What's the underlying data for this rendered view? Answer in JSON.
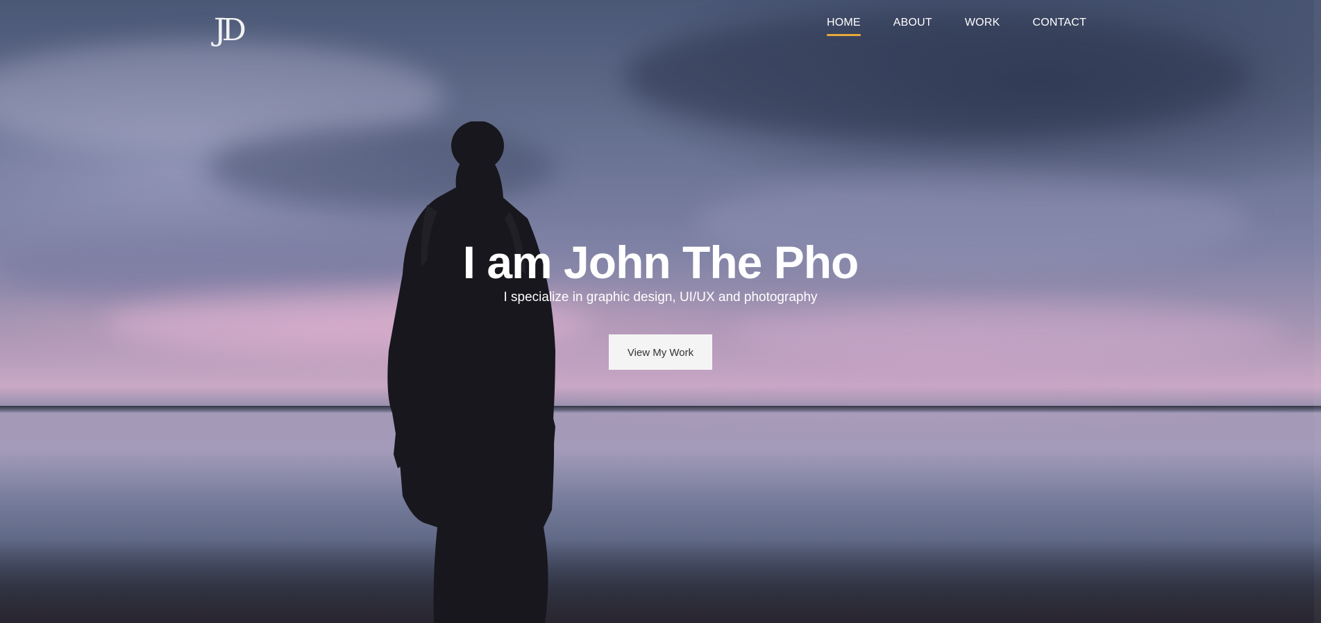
{
  "brand": {
    "logo_text": "JD"
  },
  "nav": {
    "items": [
      {
        "label": "HOME",
        "active": true
      },
      {
        "label": "ABOUT",
        "active": false
      },
      {
        "label": "WORK",
        "active": false
      },
      {
        "label": "CONTACT",
        "active": false
      }
    ],
    "active_underline_color": "#e8a93a"
  },
  "hero": {
    "title": "I am John The Pho",
    "subtitle": "I specialize in graphic design, UI/UX and photography",
    "cta_label": "View My Work"
  }
}
